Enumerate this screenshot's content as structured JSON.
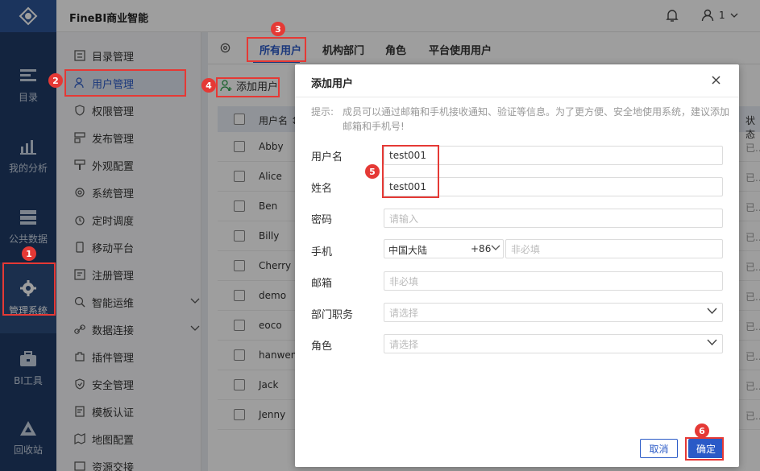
{
  "app": {
    "brand": "FineBI商业智能"
  },
  "header": {
    "user_label": "1",
    "bell_icon": "bell-icon",
    "user_icon": "user-icon"
  },
  "left_nav": {
    "items": [
      {
        "label": "目录",
        "icon": "catalog-icon"
      },
      {
        "label": "我的分析",
        "icon": "analysis-icon"
      },
      {
        "label": "公共数据",
        "icon": "public-data-icon"
      },
      {
        "label": "管理系统",
        "icon": "gear-icon"
      },
      {
        "label": "BI工具",
        "icon": "toolbox-icon"
      },
      {
        "label": "回收站",
        "icon": "recycle-icon"
      }
    ],
    "active_index": 3
  },
  "sub_nav": {
    "items": [
      {
        "label": "目录管理",
        "icon": "list-icon"
      },
      {
        "label": "用户管理",
        "icon": "user-icon"
      },
      {
        "label": "权限管理",
        "icon": "shield-icon"
      },
      {
        "label": "发布管理",
        "icon": "publish-icon"
      },
      {
        "label": "外观配置",
        "icon": "brush-icon"
      },
      {
        "label": "系统管理",
        "icon": "settings-icon"
      },
      {
        "label": "定时调度",
        "icon": "clock-icon"
      },
      {
        "label": "移动平台",
        "icon": "mobile-icon"
      },
      {
        "label": "注册管理",
        "icon": "register-icon"
      },
      {
        "label": "智能运维",
        "icon": "ops-icon"
      },
      {
        "label": "数据连接",
        "icon": "link-icon"
      },
      {
        "label": "插件管理",
        "icon": "plugin-icon"
      },
      {
        "label": "安全管理",
        "icon": "security-icon"
      },
      {
        "label": "模板认证",
        "icon": "template-icon"
      },
      {
        "label": "地图配置",
        "icon": "map-icon"
      },
      {
        "label": "资源交接",
        "icon": "resource-icon"
      }
    ],
    "active_index": 1
  },
  "main": {
    "tabs": [
      {
        "label": "所有用户"
      },
      {
        "label": "机构部门"
      },
      {
        "label": "角色"
      },
      {
        "label": "平台使用用户"
      }
    ],
    "add_user_label": "添加用户",
    "table": {
      "header_name": "用户名 ↕",
      "header_status": "状态",
      "rows": [
        {
          "name": "Abby",
          "status": "已..."
        },
        {
          "name": "Alice",
          "status": "已..."
        },
        {
          "name": "Ben",
          "status": "已..."
        },
        {
          "name": "Billy",
          "status": "已..."
        },
        {
          "name": "Cherry",
          "status": "已..."
        },
        {
          "name": "demo",
          "status": "已..."
        },
        {
          "name": "eoco",
          "status": "已..."
        },
        {
          "name": "hanwen",
          "status": "已..."
        },
        {
          "name": "Jack",
          "status": "已..."
        },
        {
          "name": "Jenny",
          "status": "已..."
        }
      ]
    }
  },
  "dialog": {
    "title": "添加用户",
    "hint_label": "提示:",
    "hint_text": "成员可以通过邮箱和手机接收通知、验证等信息。为了更方便、安全地使用系统，建议添加邮箱和手机号!",
    "fields": {
      "username": {
        "label": "用户名",
        "value": "test001"
      },
      "realname": {
        "label": "姓名",
        "value": "test001"
      },
      "password": {
        "label": "密码",
        "placeholder": "请输入"
      },
      "phone": {
        "label": "手机",
        "country": "中国大陆",
        "code": "+86",
        "placeholder": "非必填"
      },
      "email": {
        "label": "邮箱",
        "placeholder": "非必填"
      },
      "department": {
        "label": "部门职务",
        "placeholder": "请选择"
      },
      "role": {
        "label": "角色",
        "placeholder": "请选择"
      }
    },
    "cancel_label": "取消",
    "ok_label": "确定"
  },
  "annotations": [
    "1",
    "2",
    "3",
    "4",
    "5",
    "6"
  ],
  "colors": {
    "accent": "#2a5ac7",
    "nav_bg": "#1f3b66",
    "annotation": "#e53935"
  }
}
